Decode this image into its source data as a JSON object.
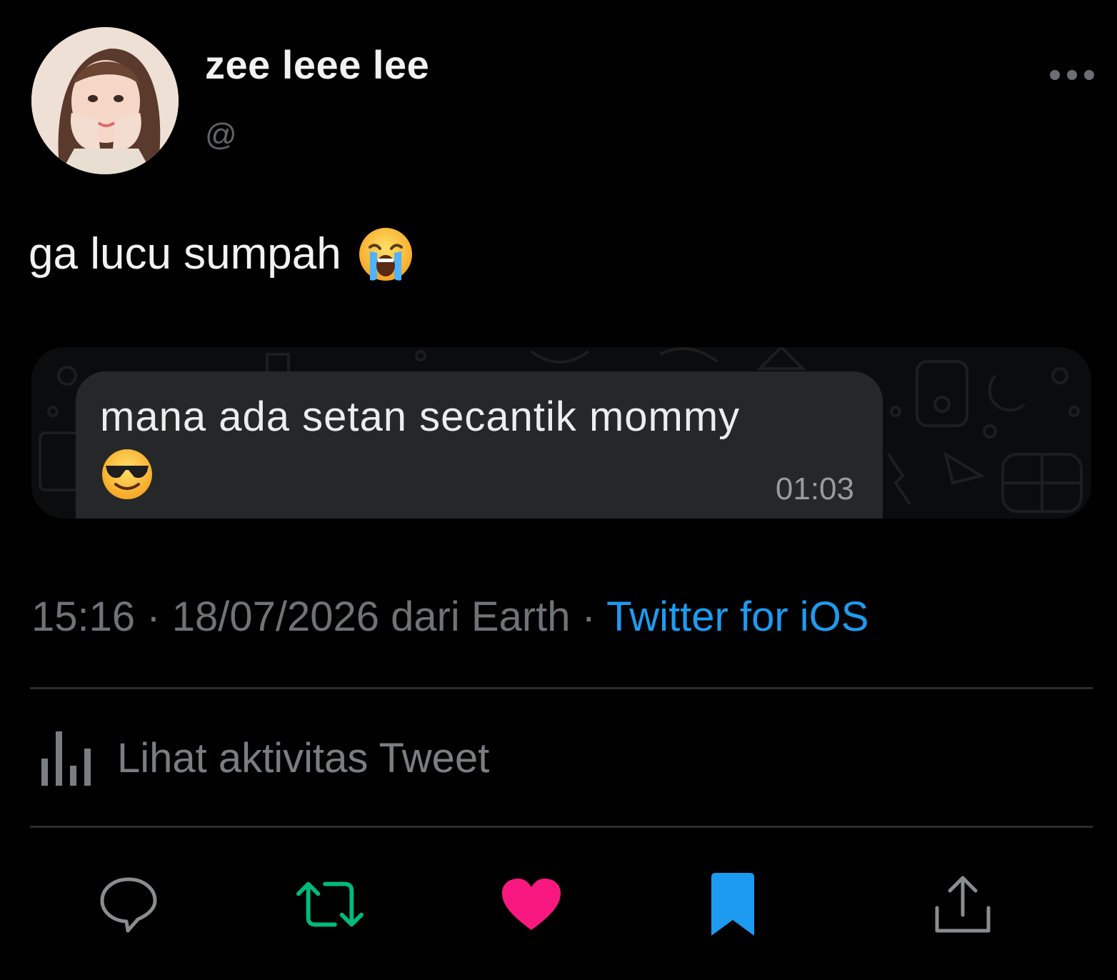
{
  "tweet": {
    "display_name": "zee leee lee",
    "handle": "@",
    "text": "ga lucu sumpah",
    "text_emoji": "loudly-crying-face",
    "embedded_chat": {
      "message": "mana ada setan secantik mommy",
      "message_emoji": "smiling-face-with-sunglasses",
      "time": "01:03"
    },
    "meta": {
      "time": "15:16",
      "separator": " · ",
      "date_location": "18/07/2026 dari Earth",
      "source": "Twitter for iOS"
    },
    "activity_label": "Lihat aktivitas Tweet"
  },
  "actions": {
    "reply": "reply-icon",
    "retweet": "retweet-icon",
    "like": "like-icon",
    "bookmark": "bookmark-icon",
    "share": "share-icon"
  },
  "colors": {
    "background": "#000000",
    "link": "#1d9bf0",
    "retweet": "#00ba7c",
    "like": "#f91880",
    "bookmark": "#1d9bf0",
    "muted": "#6f7377"
  }
}
